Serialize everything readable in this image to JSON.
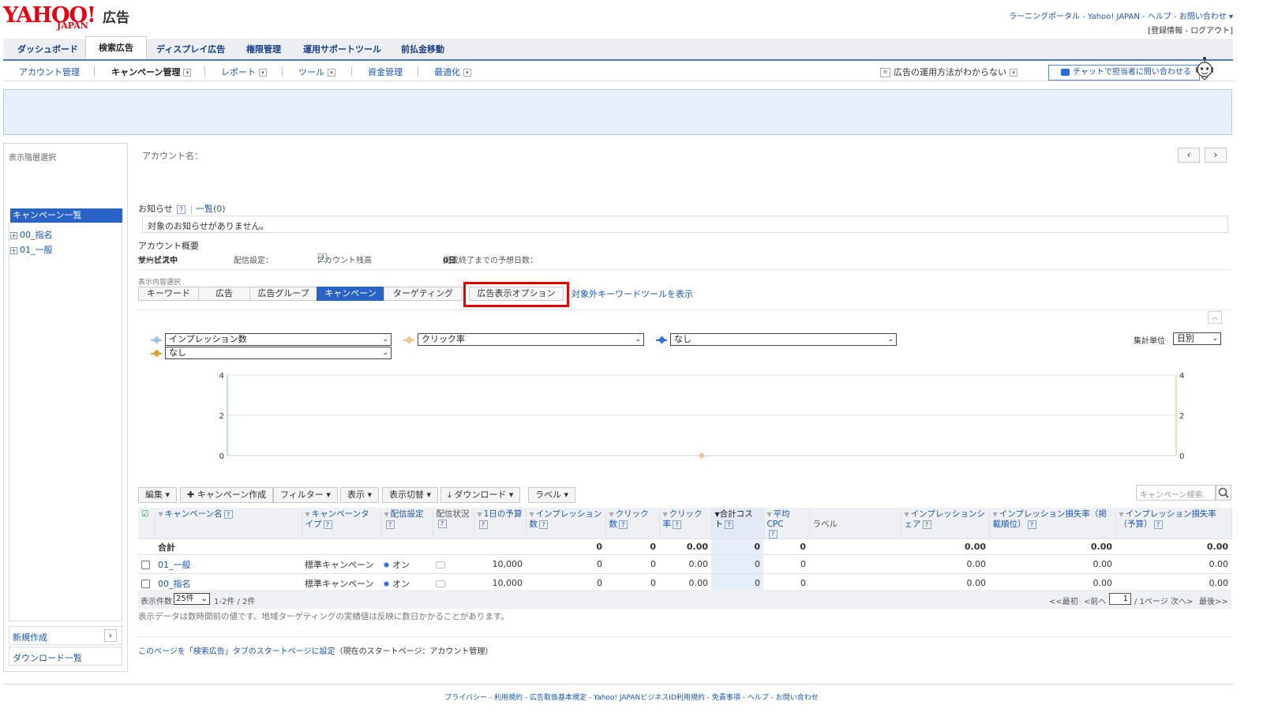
{
  "brand": {
    "logo_main": "YAHOO!",
    "logo_sub": "JAPAN",
    "logo_product": "広告"
  },
  "header": {
    "links_line1": "ラーニングポータル - Yahoo! JAPAN - ヘルプ - お問い合わせ ▾",
    "links_line2": "[登録情報 - ログアウト]"
  },
  "main_tabs": [
    "ダッシュボード",
    "検索広告",
    "ディスプレイ広告",
    "権限管理",
    "運用サポートツール",
    "前払金移動"
  ],
  "sub_nav": {
    "account": "アカウント管理",
    "campaign": "キャンペーン管理",
    "report": "レポート",
    "tool": "ツール",
    "funds": "資金管理",
    "optimize": "最適化",
    "help_question": "広告の運用方法がわからない",
    "chat": "チャットで担当者に問い合わせる"
  },
  "sidebar": {
    "title": "表示階層選択",
    "current": "キャンペーン一覧",
    "tree": [
      "00_指名",
      "01_一般"
    ],
    "new": "新規作成",
    "downloads": "ダウンロード一覧"
  },
  "account": {
    "label": "アカウント名："
  },
  "notice": {
    "label": "お知らせ",
    "list": "一覧(0)",
    "message": "対象のお知らせがありません。"
  },
  "summary": {
    "label": "アカウント概要",
    "contract_label": "契約状況：",
    "contract_value": "サービス中",
    "delivery_label": "配信設定：",
    "balance_label": "アカウント残高",
    "balance_colon": "：",
    "days_label": "掲載終了までの予想日数：",
    "days_value": "0日"
  },
  "view_select": {
    "label": "表示内容選択",
    "tabs": [
      "キーワード",
      "広告",
      "広告グループ",
      "キャンペーン",
      "ターゲティング",
      "広告表示オプション"
    ],
    "active": "キャンペーン",
    "ext_keyword": "対象外キーワードツールを表示"
  },
  "metrics": {
    "m1": "インプレッション数",
    "m2": "クリック率",
    "m3": "なし",
    "m4": "なし",
    "unit_label": "集計単位",
    "unit_value": "日別",
    "colors": {
      "m1": "#9ec3ea",
      "m2": "#f0c58a",
      "m3": "#3a6fd0",
      "m4": "#e0a030"
    }
  },
  "chart_data": {
    "type": "line",
    "y_left": {
      "ticks": [
        0,
        2,
        4
      ],
      "ylim": [
        0,
        4
      ]
    },
    "y_right": {
      "ticks": [
        0,
        2,
        4
      ],
      "ylim": [
        0,
        4
      ]
    },
    "series": [
      {
        "name": "インプレッション数",
        "values": [
          0
        ]
      },
      {
        "name": "クリック率",
        "values": [
          0
        ]
      }
    ],
    "grid": true
  },
  "toolbar": {
    "edit": "編集",
    "create": "キャンペーン作成",
    "filter": "フィルター",
    "display": "表示",
    "switch": "表示切替",
    "download": "ダウンロード",
    "label": "ラベル",
    "search_placeholder": "キャンペーン検索"
  },
  "table": {
    "headers": [
      "キャンペーン名",
      "キャンペーンタイプ",
      "配信設定",
      "配信状況",
      "1日の予算",
      "インプレッション数",
      "クリック数",
      "クリック率",
      "合計コスト",
      "平均CPC",
      "ラベル",
      "インプレッションシェア",
      "インプレッション損失率（掲載順位）",
      "インプレッション損失率（予算）"
    ],
    "total": {
      "name": "合計",
      "imp": "0",
      "clicks": "0",
      "ctr": "0.00",
      "cost": "0",
      "cpc": "0",
      "share": "0.00",
      "lost_rank": "0.00",
      "lost_budget": "0.00"
    },
    "rows": [
      {
        "name": "01_一般",
        "type": "標準キャンペーン",
        "setting": "オン",
        "budget": "10,000",
        "imp": "0",
        "clicks": "0",
        "ctr": "0.00",
        "cost": "0",
        "cpc": "0",
        "share": "0.00",
        "lost_rank": "0.00",
        "lost_budget": "0.00"
      },
      {
        "name": "00_指名",
        "type": "標準キャンペーン",
        "setting": "オン",
        "budget": "10,000",
        "imp": "0",
        "clicks": "0",
        "ctr": "0.00",
        "cost": "0",
        "cpc": "0",
        "share": "0.00",
        "lost_rank": "0.00",
        "lost_budget": "0.00"
      }
    ]
  },
  "pager": {
    "count_label": "表示件数",
    "count_value": "25件",
    "range": "1-2件 / 2件",
    "first": "<<最初",
    "prev": "<前へ",
    "page": "1",
    "of": "/ 1ページ",
    "next": "次へ>",
    "last": "最後>>"
  },
  "footnote": "表示データは数時間前の値です。地域ターゲティングの実績値は反映に数日かかることがあります。",
  "startpage": {
    "link": "このページを「検索広告」タブのスタートページに設定",
    "current": "（現在のスタートページ：アカウント管理）"
  },
  "footer": "プライバシー - 利用規約 - 広告取扱基本規定 - Yahoo! JAPANビジネスID利用規約 - 免責事項 - ヘルプ - お問い合わせ"
}
